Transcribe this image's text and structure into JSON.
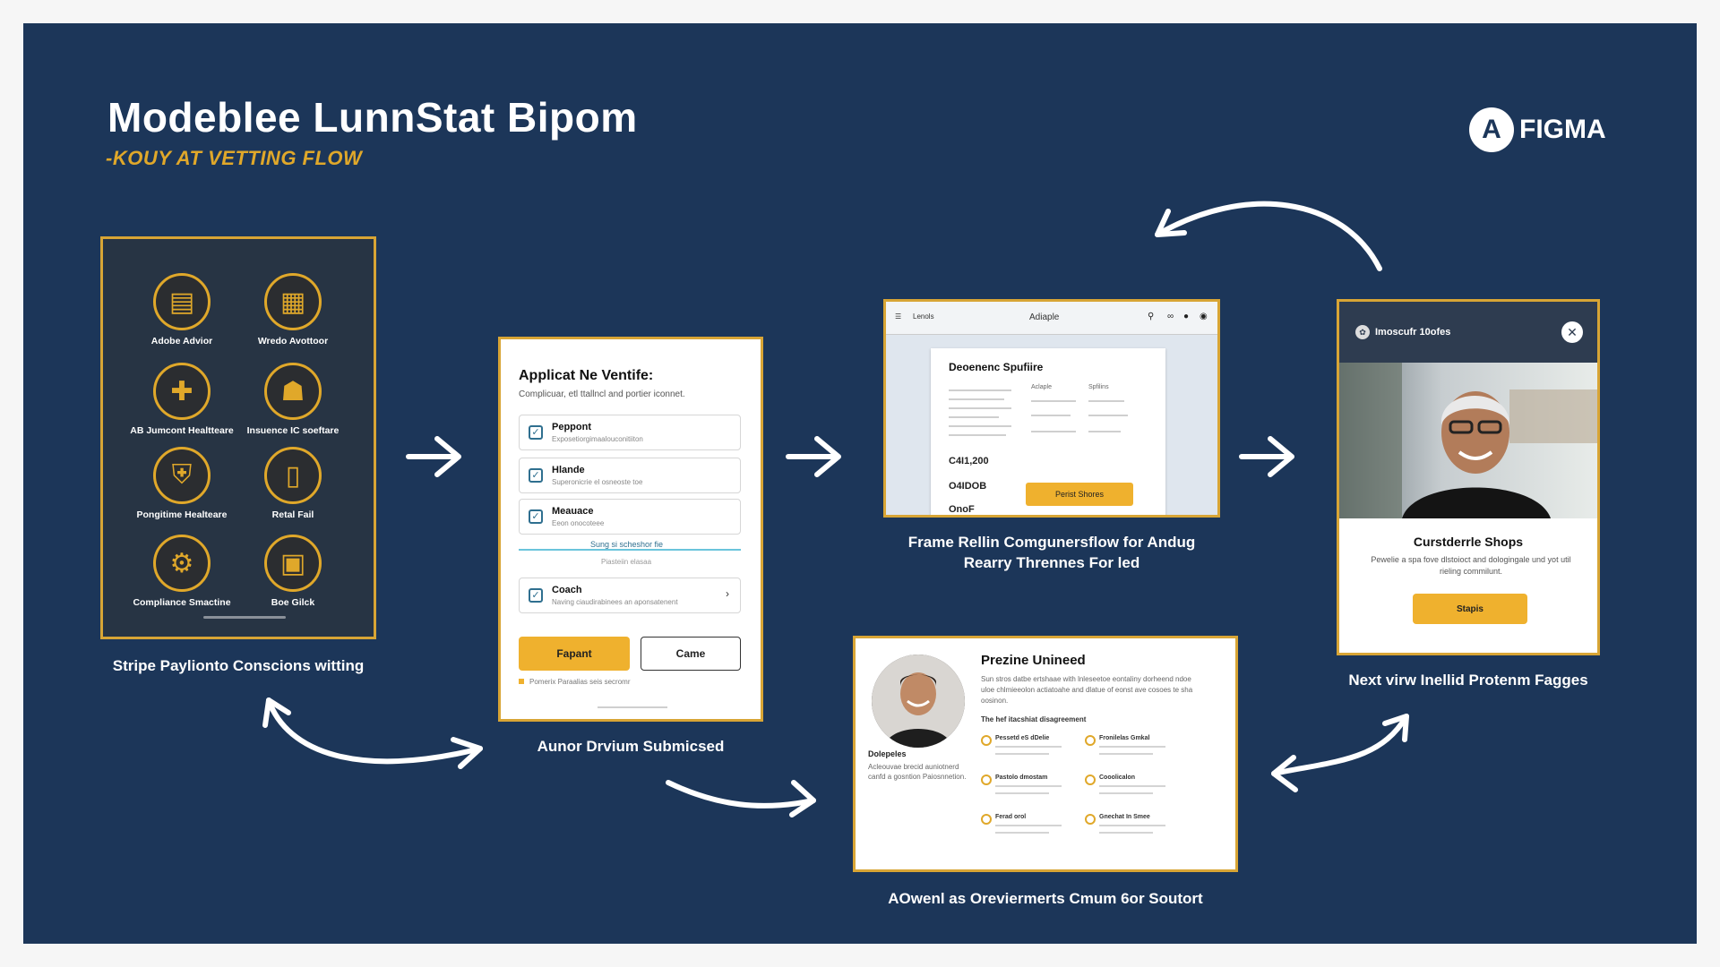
{
  "header": {
    "title": "Modeblee LunnStat Bipom",
    "subtitle": "-KOUY AT VETTING FLOW",
    "logo_mark": "A",
    "logo_text": "FIGMA"
  },
  "screen1": {
    "services": [
      {
        "label": "Adobe Advior",
        "icon": "document-icon",
        "glyph": "▤"
      },
      {
        "label": "Wredo Avottoor",
        "icon": "building-icon",
        "glyph": "▦"
      },
      {
        "label": "AB Jumcont Healtteare",
        "icon": "health-icon",
        "glyph": "✚"
      },
      {
        "label": "Insuence IC soeftare",
        "icon": "insurance-icon",
        "glyph": "☗"
      },
      {
        "label": "Pongitime Healteare",
        "icon": "shield-icon",
        "glyph": "⛨"
      },
      {
        "label": "Retal Fail",
        "icon": "phone-icon",
        "glyph": "▯"
      },
      {
        "label": "Compliance Smactine",
        "icon": "gears-icon",
        "glyph": "⚙"
      },
      {
        "label": "Boe Gilck",
        "icon": "monitor-icon",
        "glyph": "▣"
      }
    ],
    "caption": "Stripe Paylionto Conscions witting"
  },
  "screen2": {
    "title": "Applicat Ne Ventife:",
    "subtitle": "Complicuar, etl ttallncl and portier iconnet.",
    "rows": [
      {
        "label": "Peppont",
        "sub": "Exposetiorgimaalouconitiiton"
      },
      {
        "label": "Hlande",
        "sub": "Superonicrie el osneoste toe"
      },
      {
        "label": "Meauace",
        "sub": "Eeon onocoteee"
      }
    ],
    "progress_label": "Sung si scheshor fie",
    "progress_sub": "Piasteiin elasaa",
    "row4": {
      "label": "Coach",
      "sub": "Naving ciaudirabinees an aponsatenent"
    },
    "primary_button": "Fapant",
    "secondary_button": "Came",
    "footnote": "Pomerix Paraalias seis secromr",
    "caption": "Aunor Drvium Submicsed"
  },
  "screen3": {
    "menu": "Lenols",
    "brand": "Adiaple",
    "doc_title": "Deoenenc Spufiire",
    "col1": "Aclaple",
    "col2": "Spfilins",
    "amount1": "C4I1,200",
    "amount2": "O4IDOB",
    "amount3": "OnoF",
    "button": "Perist Shores",
    "caption_line1": "Frame Rellin Comgunersflow for Andug",
    "caption_line2": "Rearry Thrennes For led"
  },
  "screen4": {
    "title": "Prezine Unineed",
    "body": "Sun stros datbe ertshaae with lnleseetoe eontaliny dorheend ndoe uloe chlmieeolon actiatoahe and dlatue of eonst ave cosoes te sha oosinon.",
    "section": "The hef itacshiat disagreement",
    "person_name": "Dolepeles",
    "person_desc": "Acleouvae brecid auniotnerd canfd a gosntion Paiosnnetion.",
    "items": [
      "Pessetd eS dDelie",
      "Fronilelas Gmkal",
      "Pastolo dmostam",
      "Cooolicalon",
      "Ferad orol",
      "Gnechat In Smee"
    ],
    "caption": "AOwenl as Oreviermerts Cmum 6or Soutort"
  },
  "screen5": {
    "header_title": "Imoscufr 10ofes",
    "close": "✕",
    "title": "Curstderrle Shops",
    "body": "Pewelie a spa fove dlstoioct and dologingale und yot util rieling commilunt.",
    "button": "Stapis",
    "caption": "Next virw Inellid Protenm Fagges"
  },
  "colors": {
    "background": "#1c3659",
    "accent": "#e0a82a",
    "button": "#efb12e"
  }
}
